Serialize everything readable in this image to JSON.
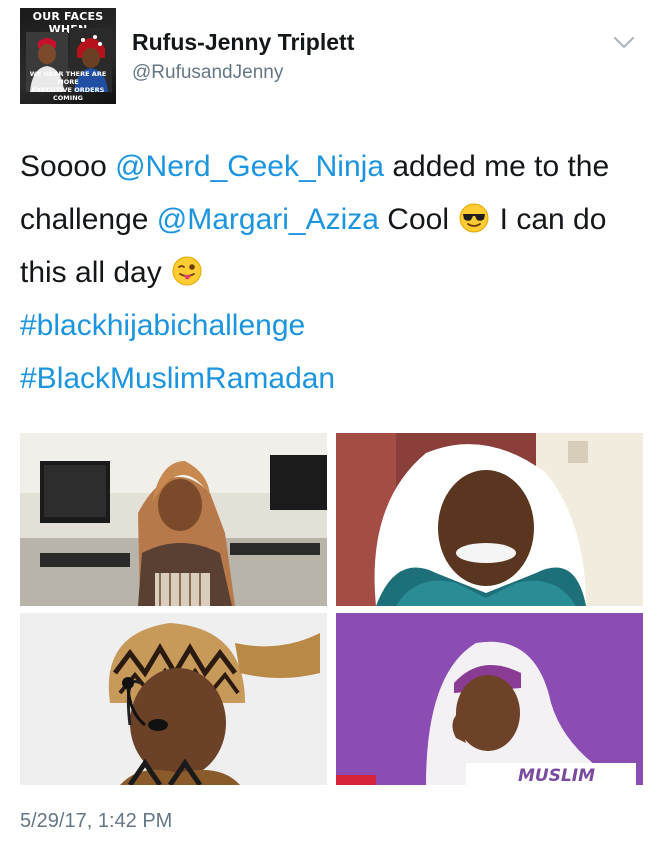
{
  "header": {
    "avatar_caption_top": "OUR FACES WHEN",
    "avatar_caption_bottom_line1": "WE HEAR THERE ARE MORE",
    "avatar_caption_bottom_line2": "EXECUTIVE ORDERS COMING",
    "display_name": "Rufus-Jenny Triplett",
    "screen_name": "@RufusandJenny",
    "menu_icon": "chevron-down-icon"
  },
  "tweet": {
    "text_1": "Soooo ",
    "mention_1": "@Nerd_Geek_Ninja",
    "text_2": " added me to the challenge ",
    "mention_2": "@Margari_Aziza",
    "text_3": " Cool ",
    "emoji_1": "sunglasses-emoji-icon",
    "text_4": " I can do this all day ",
    "emoji_2": "winking-tongue-emoji-icon",
    "hashtag_1": "#blackhijabichallenge",
    "hashtag_2": "#BlackMuslimRamadan",
    "link_color": "#1b95e0"
  },
  "media": {
    "images": [
      {
        "name": "photo-woman-orange-hijab-computer-lab"
      },
      {
        "name": "photo-woman-blue-scarf-selfie"
      },
      {
        "name": "photo-woman-patterned-headwrap-headset"
      },
      {
        "name": "photo-woman-white-hijab-purple-background"
      }
    ],
    "photo_4_overlay_text": "MUSLIM"
  },
  "footer": {
    "timestamp": "5/29/17, 1:42 PM"
  }
}
